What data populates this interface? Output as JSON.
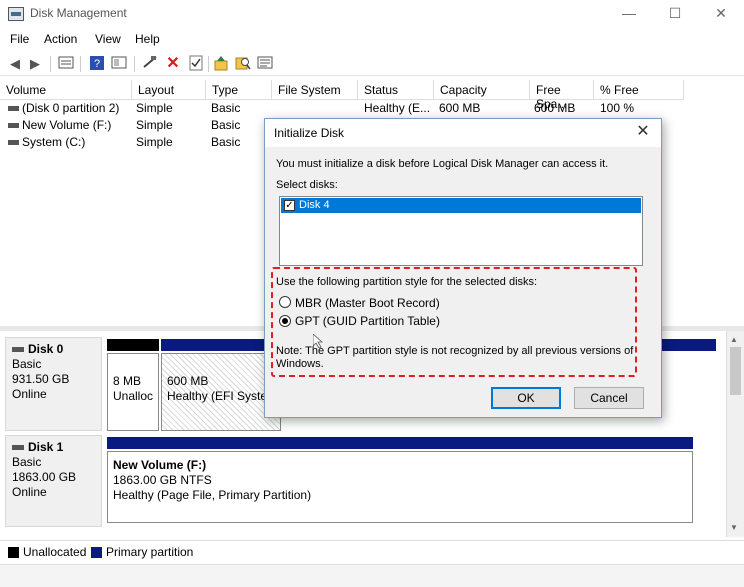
{
  "window": {
    "title": "Disk Management",
    "minimize": "—",
    "maximize": "☐",
    "close": "✕"
  },
  "menu": [
    "File",
    "Action",
    "View",
    "Help"
  ],
  "toolbar_icons": [
    "back-icon",
    "forward-icon",
    "properties-icon",
    "help-icon",
    "console-icon",
    "rescan-icon",
    "delete-icon",
    "check-icon",
    "import-icon",
    "search-icon",
    "console-list-icon"
  ],
  "table": {
    "headers": [
      "Volume",
      "Layout",
      "Type",
      "File System",
      "Status",
      "Capacity",
      "Free Spa...",
      "% Free"
    ],
    "rows": [
      [
        "(Disk 0 partition 2)",
        "Simple",
        "Basic",
        "",
        "Healthy (E...",
        "600 MB",
        "600 MB",
        "100 %"
      ],
      [
        "New Volume (F:)",
        "Simple",
        "Basic",
        "",
        "",
        "",
        "",
        ""
      ],
      [
        "System (C:)",
        "Simple",
        "Basic",
        "",
        "",
        "",
        "",
        ""
      ]
    ]
  },
  "disks": [
    {
      "name": "Disk 0",
      "type": "Basic",
      "size": "931.50 GB",
      "status": "Online",
      "partitions": [
        {
          "size": "8 MB",
          "status": "Unalloc"
        },
        {
          "size": "600 MB",
          "status": "Healthy (EFI Systen"
        }
      ]
    },
    {
      "name": "Disk 1",
      "type": "Basic",
      "size": "1863.00 GB",
      "status": "Online",
      "partitions": [
        {
          "name": "New Volume  (F:)",
          "size": "1863.00 GB NTFS",
          "status": "Healthy (Page File, Primary Partition)"
        }
      ]
    }
  ],
  "legend": [
    {
      "label": "Unallocated",
      "color": "#000000"
    },
    {
      "label": "Primary partition",
      "color": "#0a1a80"
    }
  ],
  "dialog": {
    "title": "Initialize Disk",
    "intro": "You must initialize a disk before Logical Disk Manager can access it.",
    "select_label": "Select disks:",
    "disk_item": "Disk 4",
    "disk_checked": true,
    "style_prompt": "Use the following partition style for the selected disks:",
    "mbr_label": "MBR (Master Boot Record)",
    "gpt_label": "GPT (GUID Partition Table)",
    "selected_style": "GPT",
    "note_line1": "Note: The GPT partition style is not recognized by all previous versions of",
    "note_line2": "Windows.",
    "ok_label": "OK",
    "cancel_label": "Cancel",
    "highlight_color": "#e02020"
  }
}
